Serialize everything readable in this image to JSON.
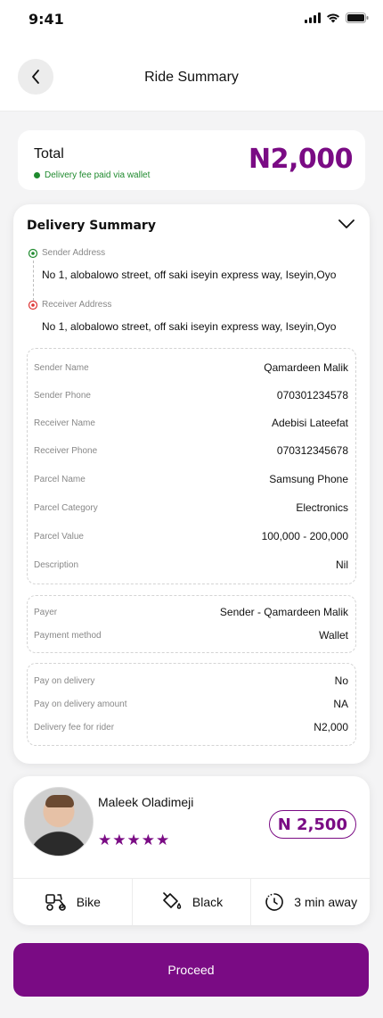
{
  "status_bar": {
    "time": "9:41"
  },
  "header": {
    "title": "Ride Summary"
  },
  "total": {
    "label": "Total",
    "note": "Delivery fee paid via wallet",
    "amount": "N2,000"
  },
  "summary": {
    "title": "Delivery Summary",
    "sender_address_label": "Sender Address",
    "sender_address": "No 1, alobalowo street, off saki iseyin express way, Iseyin,Oyo",
    "receiver_address_label": "Receiver Address",
    "receiver_address": "No 1, alobalowo street, off saki iseyin express way, Iseyin,Oyo",
    "details": [
      {
        "label": "Sender Name",
        "value": "Qamardeen Malik"
      },
      {
        "label": "Sender Phone",
        "value": "070301234578"
      },
      {
        "label": "Receiver Name",
        "value": "Adebisi Lateefat"
      },
      {
        "label": "Receiver Phone",
        "value": "070312345678"
      },
      {
        "label": "Parcel Name",
        "value": "Samsung Phone"
      },
      {
        "label": "Parcel Category",
        "value": "Electronics"
      },
      {
        "label": "Parcel Value",
        "value": "100,000 - 200,000"
      },
      {
        "label": "Description",
        "value": "Nil"
      }
    ],
    "payment": [
      {
        "label": "Payer",
        "value": "Sender - Qamardeen Malik"
      },
      {
        "label": "Payment method",
        "value": "Wallet"
      }
    ],
    "delivery_pay": [
      {
        "label": "Pay on delivery",
        "value": "No"
      },
      {
        "label": "Pay on delivery amount",
        "value": "NA"
      },
      {
        "label": "Delivery fee for rider",
        "value": "N2,000"
      }
    ]
  },
  "rider": {
    "name": "Maleek Oladimeji",
    "rating": 5,
    "stars": "★★★★★",
    "price": "N 2,500",
    "vehicle": "Bike",
    "color": "Black",
    "eta": "3 min away"
  },
  "actions": {
    "proceed": "Proceed"
  },
  "colors": {
    "accent": "#7a0b84",
    "success": "#1f8a2e"
  }
}
